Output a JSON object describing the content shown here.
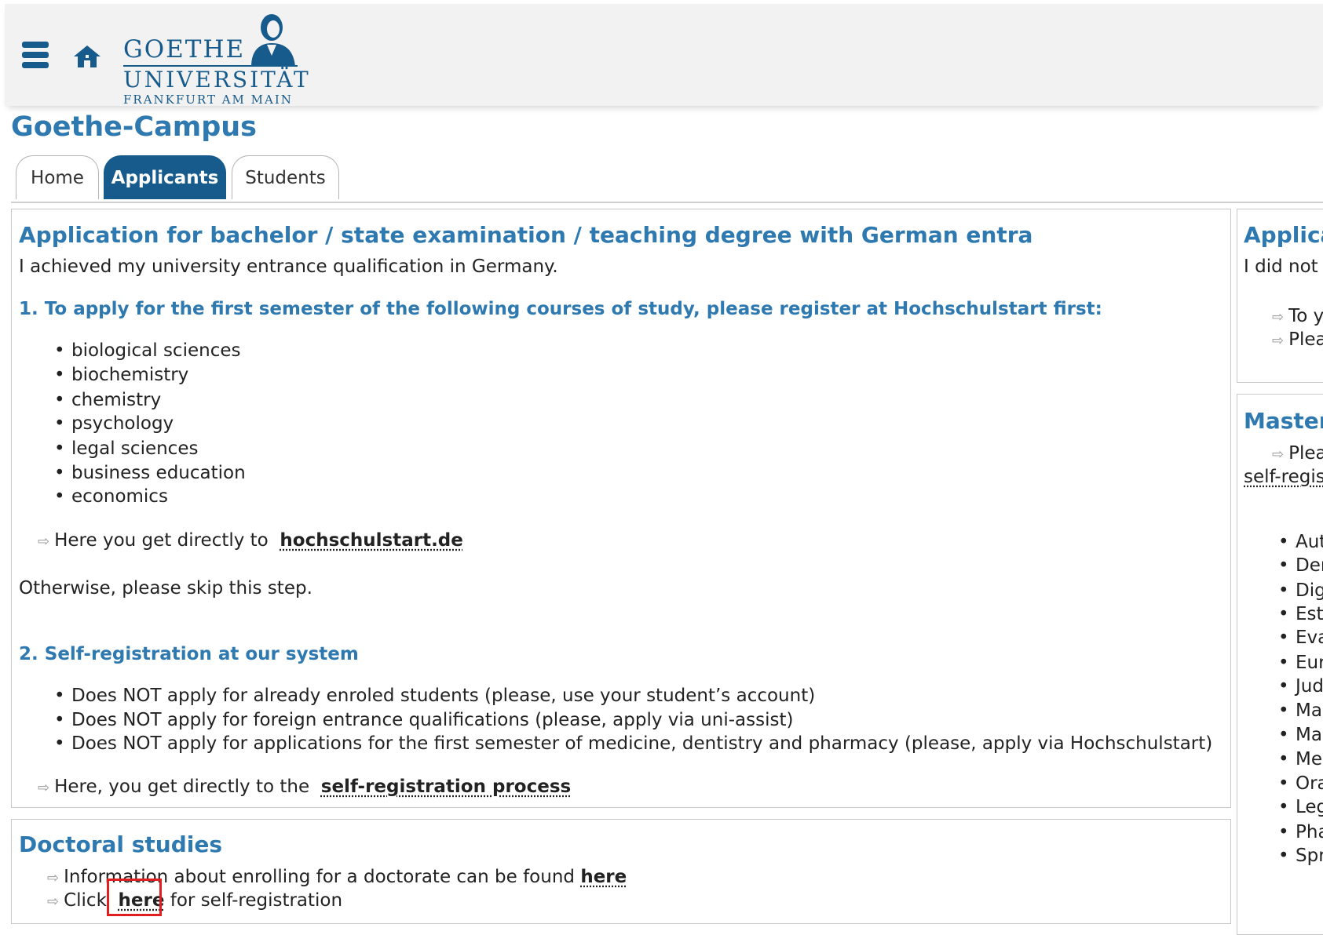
{
  "header": {
    "logo_line1": "GOETHE",
    "logo_line2": "UNIVERSITÄT",
    "logo_line3": "FRANKFURT AM MAIN"
  },
  "page": {
    "title": "Goethe-Campus"
  },
  "tabs": [
    {
      "label": "Home",
      "active": false
    },
    {
      "label": "Applicants",
      "active": true
    },
    {
      "label": "Students",
      "active": false
    }
  ],
  "bachelor": {
    "title": "Application for bachelor / state examination / teaching degree with German entra",
    "intro": "I achieved my university entrance qualification in Germany.",
    "step1_title": "1. To apply for the first semester of the following courses of study, please register at Hochschulstart first:",
    "courses": [
      "biological sciences",
      "biochemistry",
      "chemistry",
      "psychology",
      "legal sciences",
      "business education",
      "economics"
    ],
    "hs_text": "Here you get directly to",
    "hs_link": "hochschulstart.de",
    "skip": "Otherwise, please skip this step.",
    "step2_title": "2. Self-registration at our system",
    "notes": [
      "Does NOT apply for already enroled students (please, use your student’s account)",
      "Does NOT apply for foreign entrance qualifications (please, apply via uni-assist)",
      "Does NOT apply for applications for the first semester of medicine, dentistry and pharmacy (please, apply via Hochschulstart)"
    ],
    "self_text": "Here, you get directly to the",
    "self_link": "self-registration process"
  },
  "doctoral": {
    "title": "Doctoral studies",
    "info_text": "Information about enrolling for a doctorate can be found",
    "info_link": "here",
    "click_text": "Click",
    "click_link": "here",
    "click_after": "for self-registration"
  },
  "right_top": {
    "title": "Applicat",
    "intro": "I did not a",
    "links": [
      "To y",
      "Plea"
    ]
  },
  "right_master": {
    "title": "Master",
    "line1": "Plea",
    "line2": "self-regist",
    "items": [
      "Aut",
      "Der",
      "Dig",
      "Est",
      "Eva",
      "Eur",
      "Jud",
      "Ma",
      "Ma",
      "Me",
      "Ora",
      "Leg",
      "Pha",
      "Spr"
    ]
  }
}
